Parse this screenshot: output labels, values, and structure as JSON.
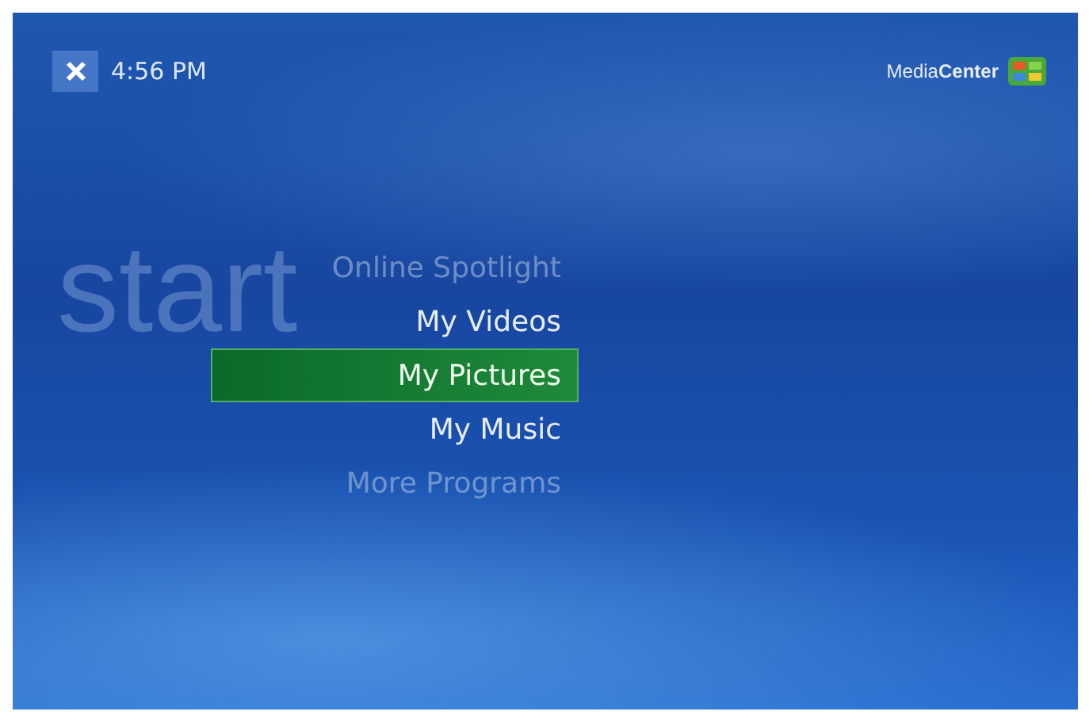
{
  "header": {
    "time": "4:56 PM",
    "logo": "Media**Center**"
  },
  "watermark": "start",
  "menu": [
    {
      "label": "Online Spotlight",
      "selected": false,
      "kind": "faded"
    },
    {
      "label": "My Videos",
      "selected": false,
      "kind": "normal"
    },
    {
      "label": "My Pictures",
      "selected": true,
      "kind": "normal"
    },
    {
      "label": "My Music",
      "selected": false,
      "kind": "normal"
    },
    {
      "label": "More Programs",
      "selected": false,
      "kind": "faded"
    }
  ]
}
